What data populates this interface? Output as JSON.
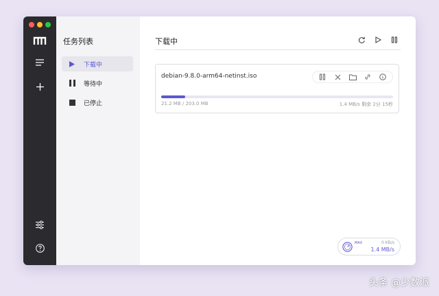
{
  "sidebar": {
    "icons": [
      "app-logo-icon",
      "menu-icon",
      "add-icon",
      "settings-sliders-icon",
      "help-icon"
    ]
  },
  "task_panel": {
    "title": "任务列表",
    "items": [
      {
        "label": "下载中",
        "icon": "play-icon",
        "active": true
      },
      {
        "label": "等待中",
        "icon": "pause-icon",
        "active": false
      },
      {
        "label": "已停止",
        "icon": "stop-icon",
        "active": false
      }
    ]
  },
  "main": {
    "title": "下载中",
    "header_actions": [
      "refresh-icon",
      "play-icon",
      "pause-icon"
    ]
  },
  "task": {
    "filename": "debian-9.8.0-arm64-netinst.iso",
    "size_progress": "21.2 MB / 203.0 MB",
    "speed_remaining": "1.4 MB/s 剩余 2分 15秒",
    "progress_fraction": 0.104,
    "actions": [
      "pause-icon",
      "close-icon",
      "folder-icon",
      "link-icon",
      "info-icon"
    ]
  },
  "speedometer": {
    "max_label": "MAX",
    "upload_speed": "0 KB/s",
    "download_speed": "1.4 MB/s"
  },
  "watermark": "头条 @少数派",
  "colors": {
    "accent": "#5b57d1",
    "sidebar_dark": "#2b2a2e",
    "task_panel_bg": "#f4f4f7",
    "background": "#e9e3f4"
  }
}
